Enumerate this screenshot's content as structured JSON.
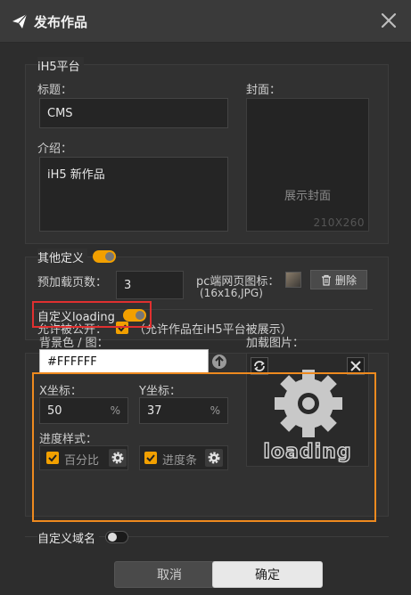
{
  "dialog": {
    "title": "发布作品"
  },
  "platform": {
    "group_label": "iH5平台",
    "title_label": "标题：",
    "title_value": "CMS",
    "intro_label": "介绍：",
    "intro_value": "iH5 新作品",
    "cover_label": "封面：",
    "cover_text": "展示封面",
    "cover_size": "210X260"
  },
  "other": {
    "group_label": "其他定义",
    "preload_label": "预加载页数：",
    "preload_value": "3",
    "pc_icon_label": "pc端网页图标：",
    "pc_icon_hint": "(16x16,JPG)",
    "delete_label": "删除",
    "public_label": "允许被公开：",
    "public_hint": "（允许作品在iH5平台被展示）"
  },
  "loading": {
    "group_label": "自定义loading",
    "bg_label": "背景色 / 图：",
    "bg_value": "#FFFFFF",
    "image_label": "加载图片：",
    "x_label": "X坐标：",
    "x_value": "50",
    "x_unit": "%",
    "y_label": "Y坐标：",
    "y_value": "37",
    "y_unit": "%",
    "progress_label": "进度样式：",
    "percent_label": "百分比",
    "bar_label": "进度条",
    "preview_text": "loading"
  },
  "domain": {
    "group_label": "自定义域名"
  },
  "footer": {
    "cancel_label": "取消",
    "ok_label": "确定"
  },
  "colors": {
    "accent": "#f2a000",
    "highlight_red": "#e03030",
    "highlight_orange": "#ee8a1f",
    "ok_button": "#e8e8e8",
    "cancel_button": "#4a4a4a"
  }
}
